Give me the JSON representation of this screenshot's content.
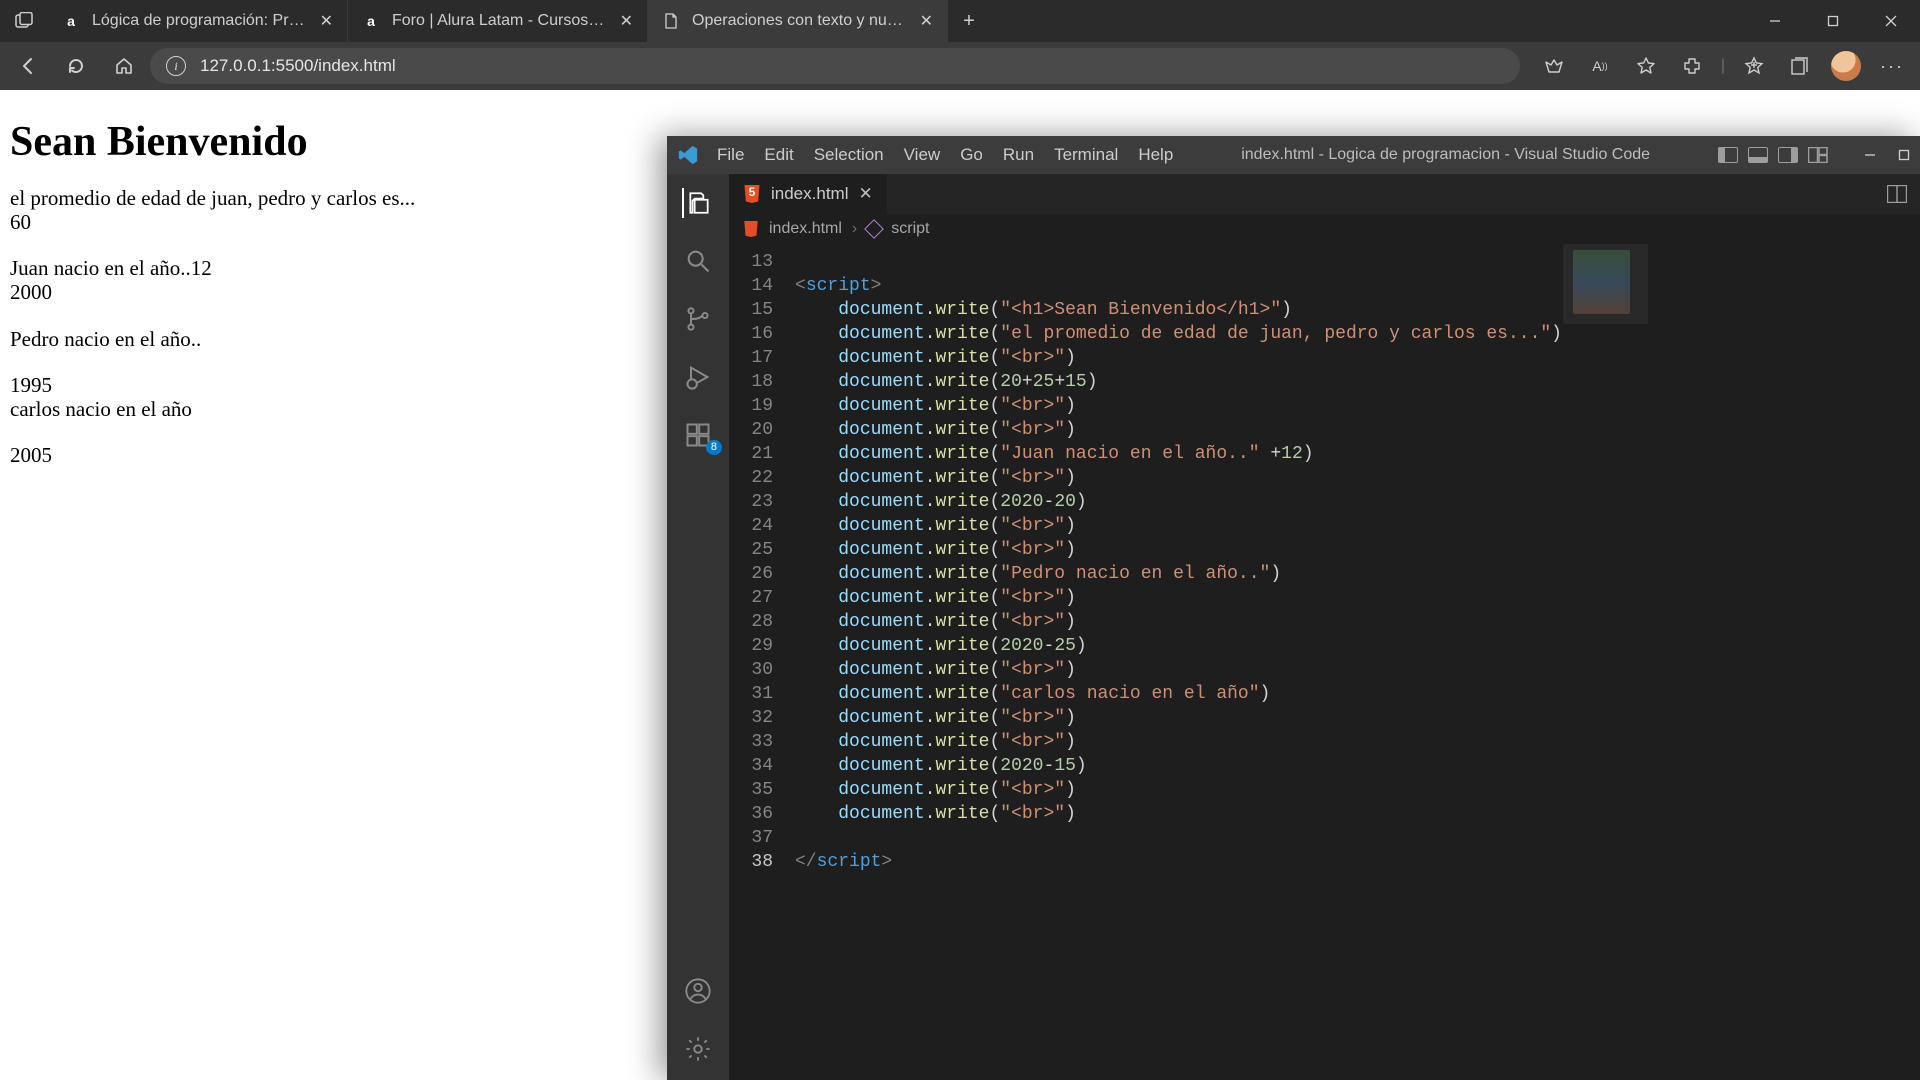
{
  "browser": {
    "tabs": [
      {
        "title": "Lógica de programación: Primer",
        "favicon": "a"
      },
      {
        "title": "Foro | Alura Latam - Cursos onlin",
        "favicon": "a"
      },
      {
        "title": "Operaciones con texto y numero",
        "favicon": "doc",
        "active": true
      }
    ],
    "url": "127.0.0.1:5500/index.html"
  },
  "page": {
    "heading": "Sean Bienvenido",
    "p1_l1": "el promedio de edad de juan, pedro y carlos es...",
    "p1_l2": "60",
    "p2_l1": "Juan nacio en el año..12",
    "p2_l2": "2000",
    "p3_l1": "Pedro nacio en el año..",
    "p4_l1": "1995",
    "p4_l2": "carlos nacio en el año",
    "p5_l1": "2005"
  },
  "vscode": {
    "menu": [
      "File",
      "Edit",
      "Selection",
      "View",
      "Go",
      "Run",
      "Terminal",
      "Help"
    ],
    "window_title": "index.html - Logica de programacion - Visual Studio Code",
    "tab_label": "index.html",
    "breadcrumb_file": "index.html",
    "breadcrumb_node": "script",
    "extensions_badge": "8",
    "line_start": 13,
    "code": [
      {
        "n": 13,
        "kind": "blank"
      },
      {
        "n": 14,
        "kind": "open_tag",
        "tag": "script"
      },
      {
        "n": 15,
        "kind": "write_str",
        "str": "\"<h1>Sean Bienvenido</h1>\""
      },
      {
        "n": 16,
        "kind": "write_str",
        "str": "\"el promedio de edad de juan, pedro y carlos es...\""
      },
      {
        "n": 17,
        "kind": "write_str",
        "str": "\"<br>\""
      },
      {
        "n": 18,
        "kind": "write_expr",
        "tokens": [
          [
            "num",
            "20"
          ],
          [
            "op",
            "+"
          ],
          [
            "num",
            "25"
          ],
          [
            "op",
            "+"
          ],
          [
            "num",
            "15"
          ]
        ]
      },
      {
        "n": 19,
        "kind": "write_str",
        "str": "\"<br>\""
      },
      {
        "n": 20,
        "kind": "write_str",
        "str": "\"<br>\""
      },
      {
        "n": 21,
        "kind": "write_str_plus",
        "str": "\"Juan nacio en el año..\"",
        "plus": [
          [
            "op",
            " +"
          ],
          [
            "num",
            "12"
          ]
        ]
      },
      {
        "n": 22,
        "kind": "write_str",
        "str": "\"<br>\""
      },
      {
        "n": 23,
        "kind": "write_expr",
        "tokens": [
          [
            "num",
            "2020"
          ],
          [
            "op",
            "-"
          ],
          [
            "num",
            "20"
          ]
        ]
      },
      {
        "n": 24,
        "kind": "write_str",
        "str": "\"<br>\""
      },
      {
        "n": 25,
        "kind": "write_str",
        "str": "\"<br>\""
      },
      {
        "n": 26,
        "kind": "write_str",
        "str": "\"Pedro nacio en el año..\""
      },
      {
        "n": 27,
        "kind": "write_str",
        "str": "\"<br>\""
      },
      {
        "n": 28,
        "kind": "write_str",
        "str": "\"<br>\""
      },
      {
        "n": 29,
        "kind": "write_expr",
        "tokens": [
          [
            "num",
            "2020"
          ],
          [
            "op",
            "-"
          ],
          [
            "num",
            "25"
          ]
        ]
      },
      {
        "n": 30,
        "kind": "write_str",
        "str": "\"<br>\""
      },
      {
        "n": 31,
        "kind": "write_str",
        "str": "\"carlos nacio en el año\""
      },
      {
        "n": 32,
        "kind": "write_str",
        "str": "\"<br>\""
      },
      {
        "n": 33,
        "kind": "write_str",
        "str": "\"<br>\""
      },
      {
        "n": 34,
        "kind": "write_expr",
        "tokens": [
          [
            "num",
            "2020"
          ],
          [
            "op",
            "-"
          ],
          [
            "num",
            "15"
          ]
        ]
      },
      {
        "n": 35,
        "kind": "write_str",
        "str": "\"<br>\""
      },
      {
        "n": 36,
        "kind": "write_str",
        "str": "\"<br>\""
      },
      {
        "n": 37,
        "kind": "blank"
      },
      {
        "n": 38,
        "kind": "close_tag",
        "tag": "script",
        "current": true
      }
    ]
  }
}
